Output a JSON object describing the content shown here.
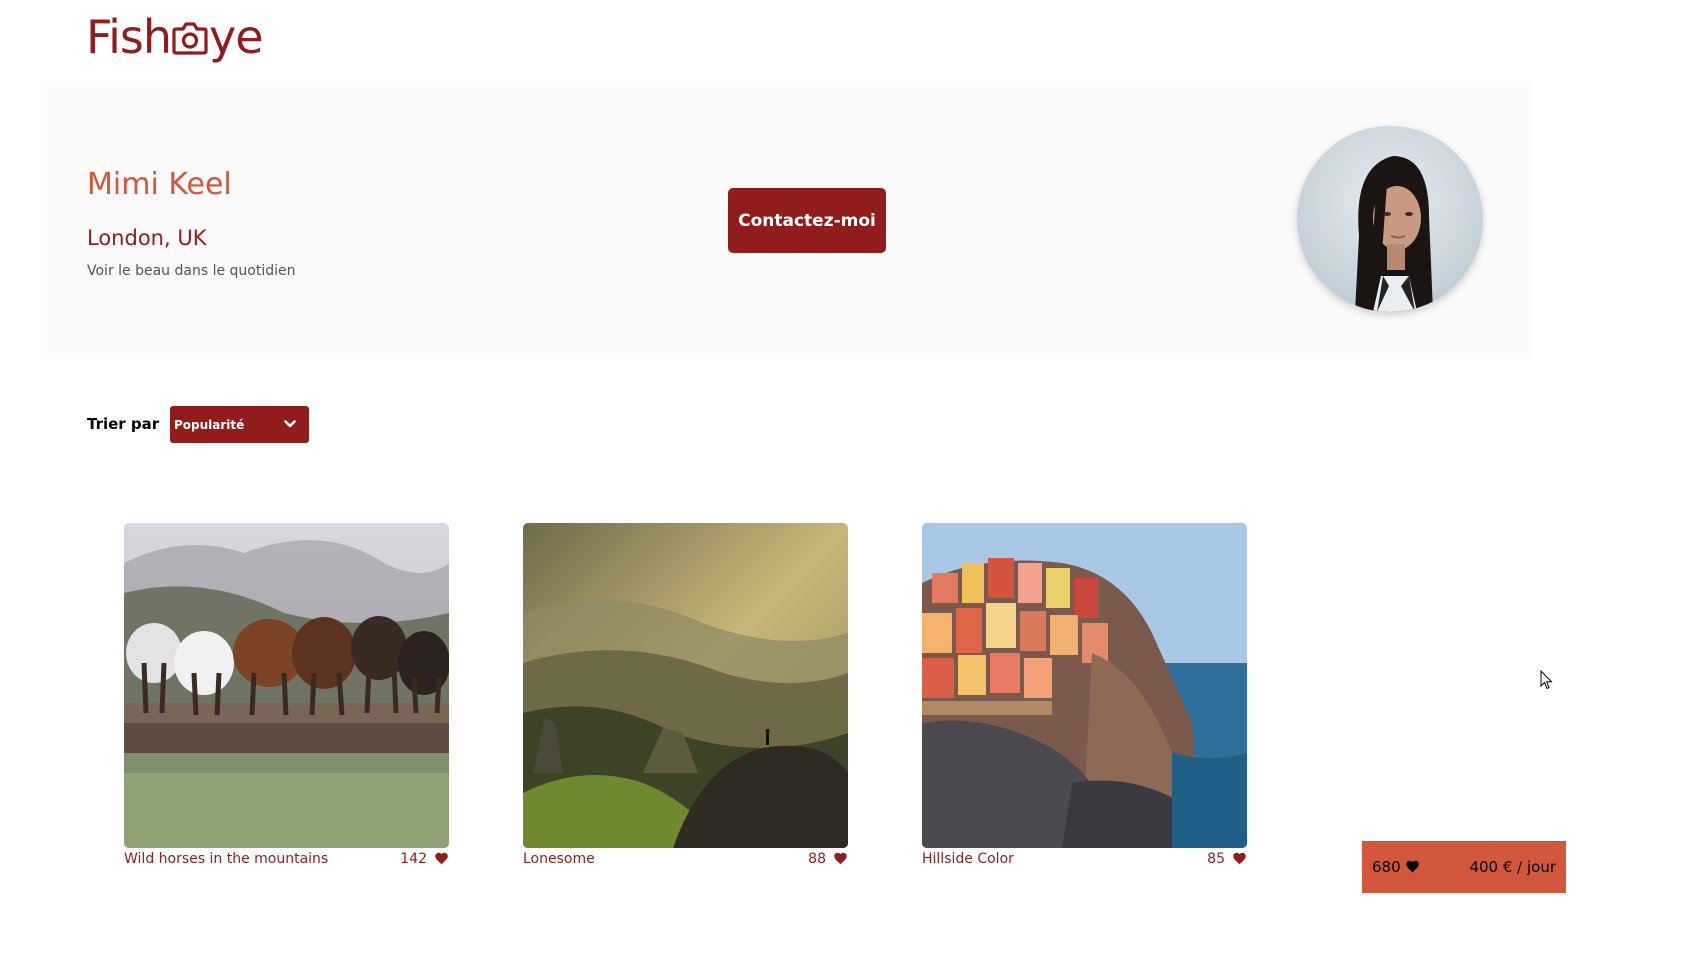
{
  "logo": {
    "text_before": "Fish",
    "text_after": "ye",
    "icon": "camera-icon",
    "color": "#901C1C"
  },
  "photographer": {
    "name": "Mimi Keel",
    "location": "London, UK",
    "tagline": "Voir le beau dans le quotidien",
    "contact_label": "Contactez-moi"
  },
  "sort": {
    "label": "Trier par",
    "selected": "Popularité",
    "icon": "chevron-down-icon"
  },
  "gallery": [
    {
      "title": "Wild horses in the mountains",
      "likes": "142"
    },
    {
      "title": "Lonesome",
      "likes": "88"
    },
    {
      "title": "Hillside Color",
      "likes": "85"
    }
  ],
  "summary": {
    "total_likes": "680",
    "price": "400 € / jour"
  },
  "colors": {
    "primary": "#901C1C",
    "secondary": "#D3573C",
    "card_bg": "#FAFAFA",
    "text_grey": "#525252"
  }
}
